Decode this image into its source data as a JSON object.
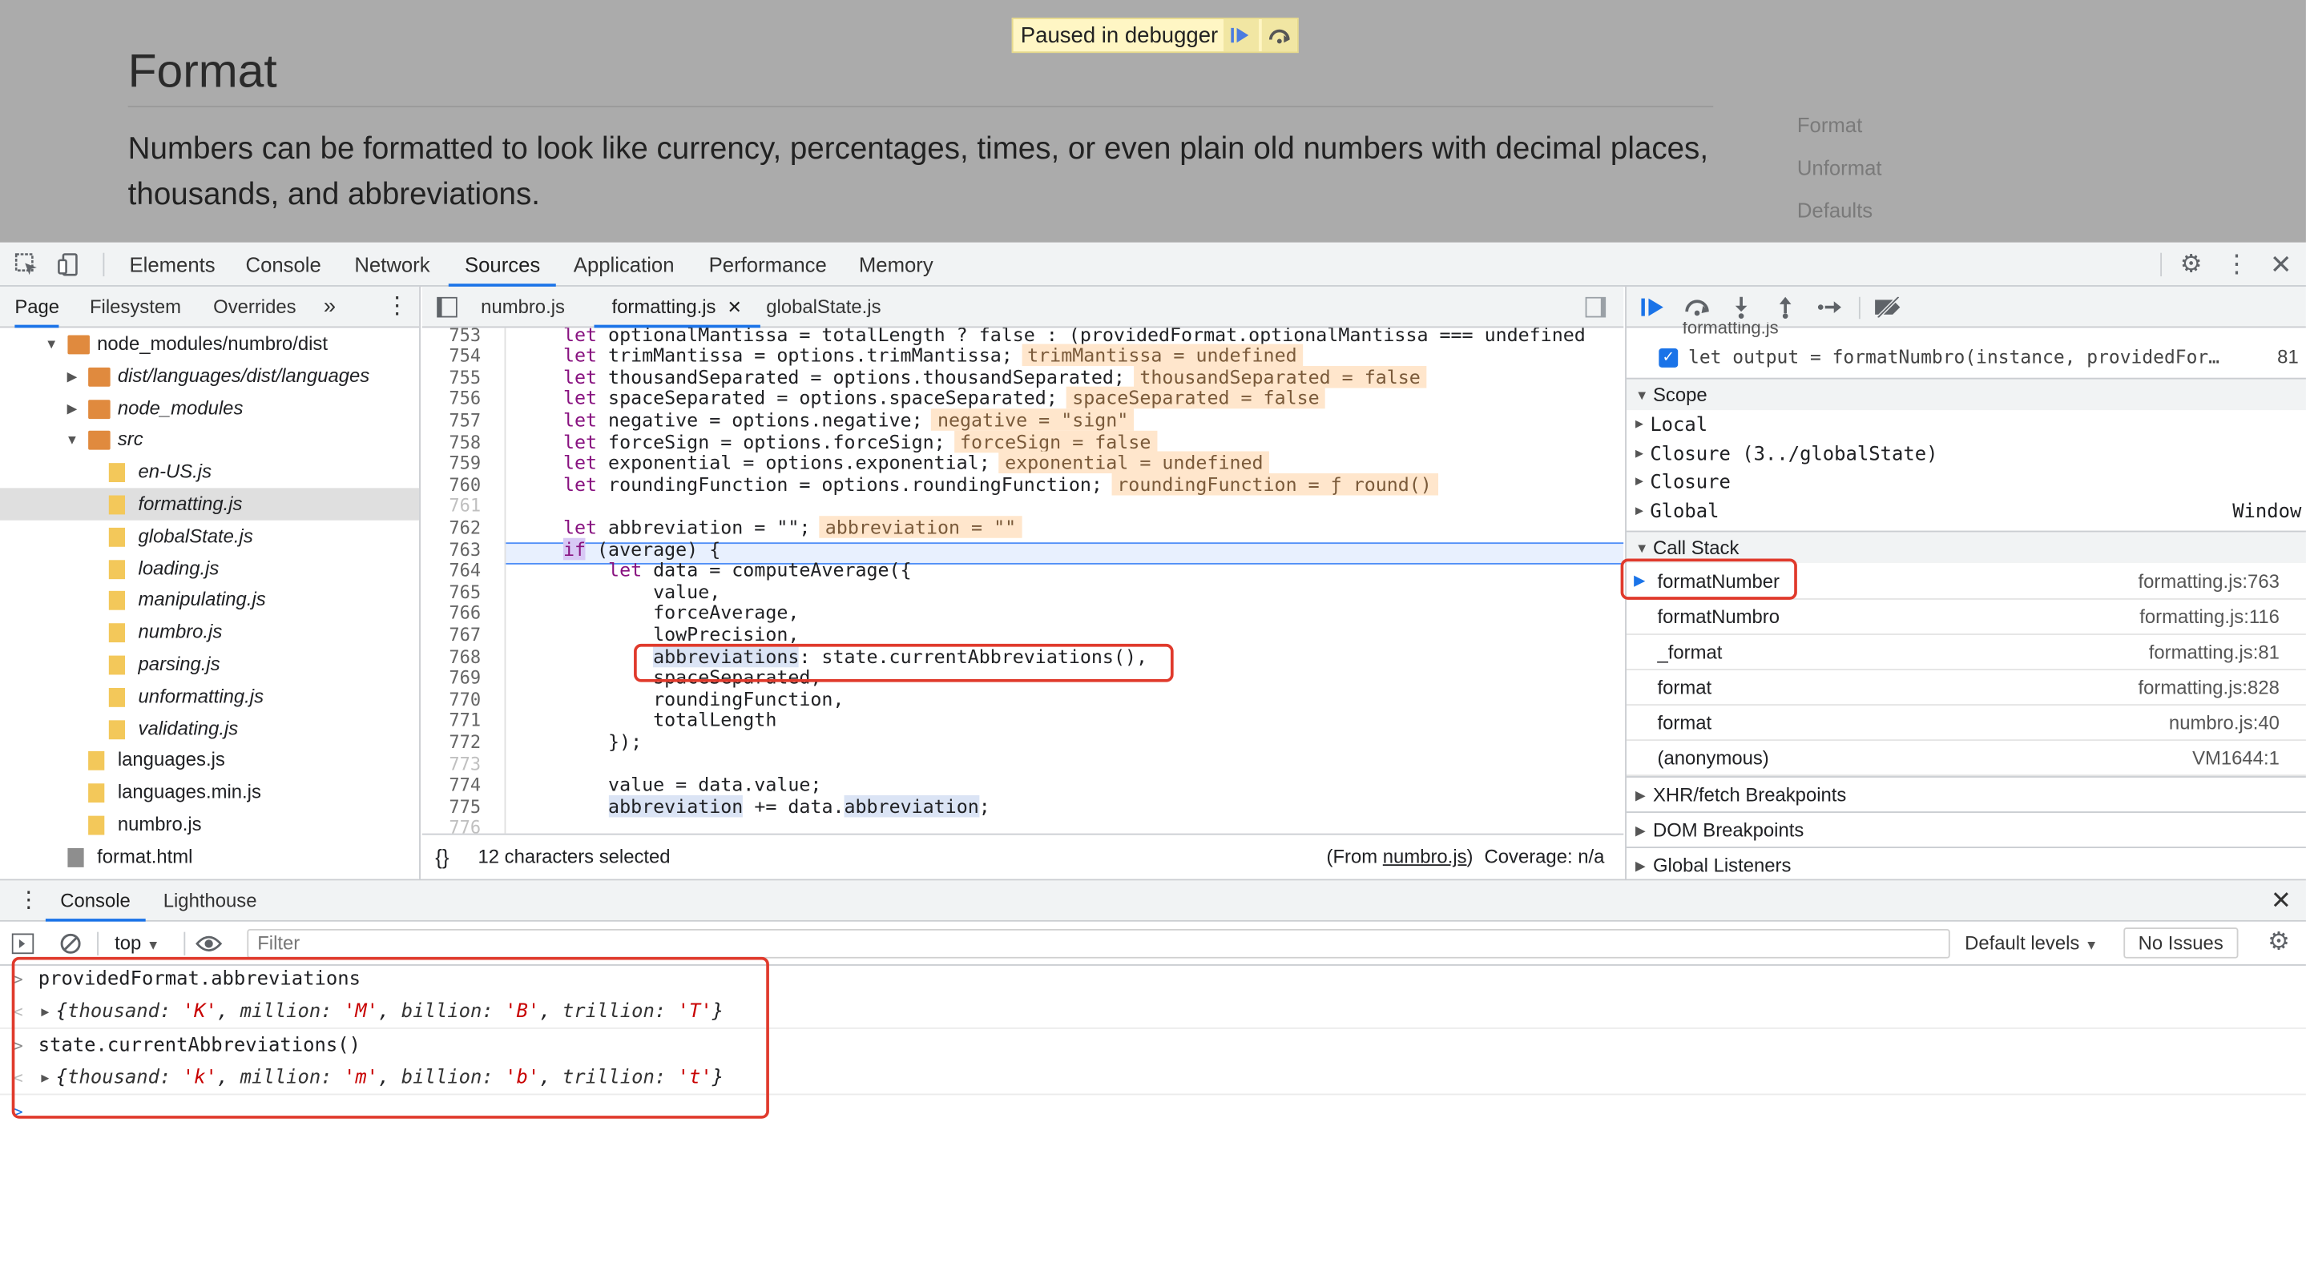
{
  "page": {
    "title": "Format",
    "description": "Numbers can be formatted to look like currency, percentages, times, or even plain old numbers with decimal places, thousands, and abbreviations.",
    "nav": [
      "Format",
      "Unformat",
      "Defaults"
    ],
    "paused_label": "Paused in debugger"
  },
  "devtools": {
    "tabs": [
      "Elements",
      "Console",
      "Network",
      "Sources",
      "Application",
      "Performance",
      "Memory"
    ],
    "active_tab": "Sources"
  },
  "navigator": {
    "tabs": [
      "Page",
      "Filesystem",
      "Overrides"
    ],
    "active_tab": "Page",
    "tree": [
      {
        "label": "node_modules/numbro/dist",
        "type": "folder",
        "open": true
      },
      {
        "label": "dist/languages/dist/languages",
        "type": "folder",
        "open": false
      },
      {
        "label": "node_modules",
        "type": "folder",
        "open": false
      },
      {
        "label": "src",
        "type": "folder",
        "open": true
      },
      {
        "label": "en-US.js",
        "type": "file"
      },
      {
        "label": "formatting.js",
        "type": "file",
        "selected": true
      },
      {
        "label": "globalState.js",
        "type": "file"
      },
      {
        "label": "loading.js",
        "type": "file"
      },
      {
        "label": "manipulating.js",
        "type": "file"
      },
      {
        "label": "numbro.js",
        "type": "file"
      },
      {
        "label": "parsing.js",
        "type": "file"
      },
      {
        "label": "unformatting.js",
        "type": "file"
      },
      {
        "label": "validating.js",
        "type": "file"
      },
      {
        "label": "languages.js",
        "type": "file"
      },
      {
        "label": "languages.min.js",
        "type": "file"
      },
      {
        "label": "numbro.js",
        "type": "file"
      },
      {
        "label": "format.html",
        "type": "html"
      }
    ]
  },
  "editor": {
    "tabs": [
      "numbro.js",
      "formatting.js",
      "globalState.js"
    ],
    "active_tab": "formatting.js",
    "lines": [
      {
        "n": "753",
        "code": "let optionalMantissa = totalLength ? false : (providedFormat.optionalMantissa === undefined"
      },
      {
        "n": "754",
        "code": "let trimMantissa = options.trimMantissa;",
        "inline": "trimMantissa = undefined"
      },
      {
        "n": "755",
        "code": "let thousandSeparated = options.thousandSeparated;",
        "inline": "thousandSeparated = false"
      },
      {
        "n": "756",
        "code": "let spaceSeparated = options.spaceSeparated;",
        "inline": "spaceSeparated = false"
      },
      {
        "n": "757",
        "code": "let negative = options.negative;",
        "inline": "negative = \"sign\""
      },
      {
        "n": "758",
        "code": "let forceSign = options.forceSign;",
        "inline": "forceSign = false"
      },
      {
        "n": "759",
        "code": "let exponential = options.exponential;",
        "inline": "exponential = undefined"
      },
      {
        "n": "760",
        "code": "let roundingFunction = options.roundingFunction;",
        "inline": "roundingFunction = ƒ round()"
      },
      {
        "n": "761",
        "code": ""
      },
      {
        "n": "762",
        "code": "let abbreviation = \"\";",
        "inline": "abbreviation = \"\""
      },
      {
        "n": "763",
        "code": "if (average) {"
      },
      {
        "n": "764",
        "code": "    let data = computeAverage({"
      },
      {
        "n": "765",
        "code": "        value,"
      },
      {
        "n": "766",
        "code": "        forceAverage,"
      },
      {
        "n": "767",
        "code": "        lowPrecision,"
      },
      {
        "n": "768",
        "code": "        abbreviations: state.currentAbbreviations(),"
      },
      {
        "n": "769",
        "code": "        spaceSeparated,"
      },
      {
        "n": "770",
        "code": "        roundingFunction,"
      },
      {
        "n": "771",
        "code": "        totalLength"
      },
      {
        "n": "772",
        "code": "    });"
      },
      {
        "n": "773",
        "code": ""
      },
      {
        "n": "774",
        "code": "    value = data.value;"
      },
      {
        "n": "775",
        "code": "    abbreviation += data.abbreviation;"
      },
      {
        "n": "776",
        "code": ""
      }
    ],
    "status": "12 characters selected",
    "from_prefix": "(From ",
    "from_file": "numbro.js",
    "from_suffix": ")",
    "coverage": "Coverage: n/a"
  },
  "debugger": {
    "breakpoint_file": "formatting.js",
    "breakpoint_code": "let output = formatNumbro(instance, providedFor…",
    "breakpoint_line": "81",
    "scope_title": "Scope",
    "scope": [
      {
        "name": "Local",
        "value": ""
      },
      {
        "name": "Closure (3../globalState)",
        "value": ""
      },
      {
        "name": "Closure",
        "value": ""
      },
      {
        "name": "Global",
        "value": "Window"
      }
    ],
    "callstack_title": "Call Stack",
    "callstack": [
      {
        "fn": "formatNumber",
        "loc": "formatting.js:763"
      },
      {
        "fn": "formatNumbro",
        "loc": "formatting.js:116"
      },
      {
        "fn": "_format",
        "loc": "formatting.js:81"
      },
      {
        "fn": "format",
        "loc": "formatting.js:828"
      },
      {
        "fn": "format",
        "loc": "numbro.js:40"
      },
      {
        "fn": "(anonymous)",
        "loc": "VM1644:1"
      }
    ],
    "sections": [
      "XHR/fetch Breakpoints",
      "DOM Breakpoints",
      "Global Listeners"
    ]
  },
  "console": {
    "tabs": [
      "Console",
      "Lighthouse"
    ],
    "context": "top",
    "filter_placeholder": "Filter",
    "levels": "Default levels",
    "issues": "No Issues",
    "entries": [
      {
        "input": "providedFormat.abbreviations",
        "output": {
          "thousand": "'K'",
          "million": "'M'",
          "billion": "'B'",
          "trillion": "'T'"
        }
      },
      {
        "input": "state.currentAbbreviations()",
        "output": {
          "thousand": "'k'",
          "million": "'m'",
          "billion": "'b'",
          "trillion": "'t'"
        }
      }
    ]
  },
  "colors": {
    "accent": "#1a73e8",
    "annotation": "#e03a2c"
  }
}
